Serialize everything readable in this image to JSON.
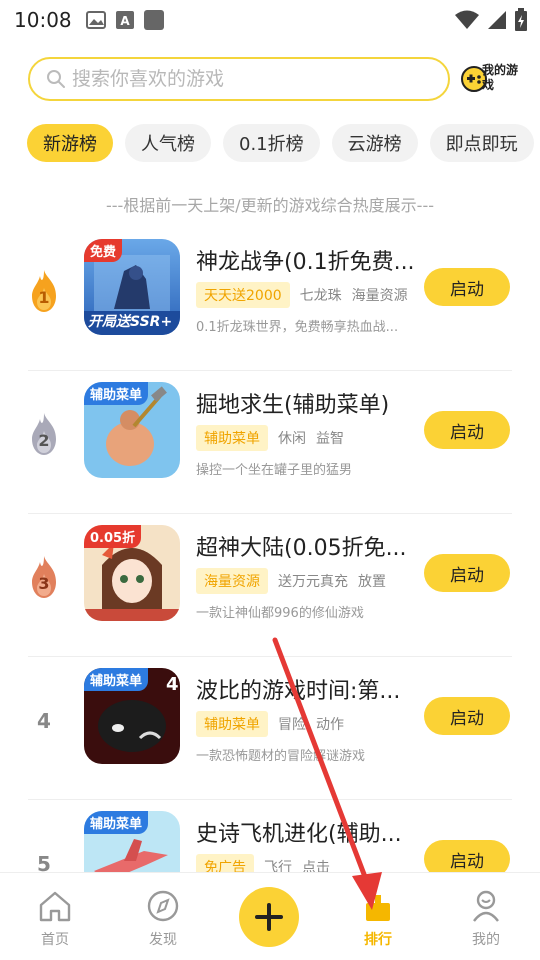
{
  "status_bar": {
    "time": "10:08"
  },
  "search": {
    "placeholder": "搜索你喜欢的游戏",
    "my_games_label": "我的游戏"
  },
  "tabs": [
    {
      "label": "新游榜",
      "active": true
    },
    {
      "label": "人气榜",
      "active": false
    },
    {
      "label": "0.1折榜",
      "active": false
    },
    {
      "label": "云游榜",
      "active": false
    },
    {
      "label": "即点即玩",
      "active": false
    }
  ],
  "subtitle": "---根据前一天上架/更新的游戏综合热度展示---",
  "games": [
    {
      "rank": "1",
      "title": "神龙战争(0.1折免费...",
      "highlight_tag": "天天送2000",
      "tags": [
        "七龙珠",
        "海量资源"
      ],
      "desc": "0.1折龙珠世界，免费畅享热血战...",
      "icon_badge": "免费",
      "icon_caption": "开局送SSR+",
      "button": "启动"
    },
    {
      "rank": "2",
      "title": "掘地求生(辅助菜单)",
      "highlight_tag": "辅助菜单",
      "tags": [
        "休闲",
        "益智"
      ],
      "desc": "操控一个坐在罐子里的猛男",
      "icon_badge": "辅助菜单",
      "icon_caption": "",
      "button": "启动"
    },
    {
      "rank": "3",
      "title": "超神大陆(0.05折免...",
      "highlight_tag": "海量资源",
      "tags": [
        "送万元真充",
        "放置"
      ],
      "desc": "一款让神仙都996的修仙游戏",
      "icon_badge": "0.05折",
      "icon_caption": "",
      "button": "启动"
    },
    {
      "rank": "4",
      "title": "波比的游戏时间:第...",
      "highlight_tag": "辅助菜单",
      "tags": [
        "冒险",
        "动作"
      ],
      "desc": "一款恐怖题材的冒险解谜游戏",
      "icon_badge": "辅助菜单",
      "icon_caption": "",
      "button": "启动"
    },
    {
      "rank": "5",
      "title": "史诗飞机进化(辅助...",
      "highlight_tag": "免广告",
      "tags": [
        "飞行",
        "点击"
      ],
      "desc": "",
      "icon_badge": "辅助菜单",
      "icon_caption": "",
      "button": "启动"
    }
  ],
  "bottom_nav": [
    {
      "label": "首页",
      "icon": "home-icon"
    },
    {
      "label": "发现",
      "icon": "compass-icon"
    },
    {
      "label": "",
      "icon": "plus-icon"
    },
    {
      "label": "排行",
      "icon": "ranking-icon",
      "active": true
    },
    {
      "label": "我的",
      "icon": "user-icon"
    }
  ],
  "colors": {
    "accent": "#fbd235",
    "accent_text": "#f5b700",
    "rank1": "#f6a21e",
    "rank2": "#a9a9b8",
    "rank3": "#e1805c",
    "annotation_arrow": "#e53935"
  }
}
